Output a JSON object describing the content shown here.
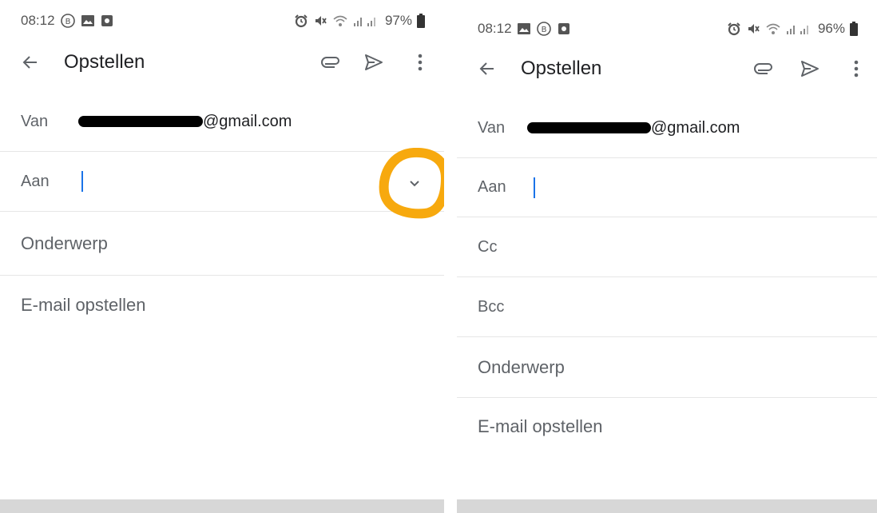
{
  "left": {
    "status": {
      "time": "08:12",
      "battery": "97%"
    },
    "toolbar": {
      "title": "Opstellen"
    },
    "from": {
      "label": "Van",
      "email_suffix": "@gmail.com"
    },
    "to": {
      "label": "Aan"
    },
    "subject": {
      "placeholder": "Onderwerp"
    },
    "body": {
      "placeholder": "E-mail opstellen"
    }
  },
  "right": {
    "status": {
      "time": "08:12",
      "battery": "96%"
    },
    "toolbar": {
      "title": "Opstellen"
    },
    "from": {
      "label": "Van",
      "email_suffix": "@gmail.com"
    },
    "to": {
      "label": "Aan"
    },
    "cc": {
      "label": "Cc"
    },
    "bcc": {
      "label": "Bcc"
    },
    "subject": {
      "placeholder": "Onderwerp"
    },
    "body": {
      "placeholder": "E-mail opstellen"
    }
  },
  "colors": {
    "highlight": "#f7a90e",
    "cursor": "#1a73e8",
    "bottom_bar": "#d7d7d7"
  }
}
